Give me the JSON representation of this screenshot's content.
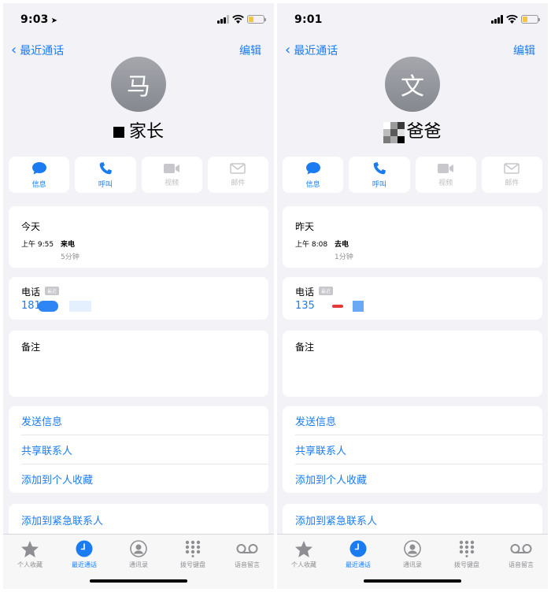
{
  "screens": [
    {
      "status": {
        "time": "9:03",
        "location_arrow": "➤"
      },
      "nav": {
        "back_label": "最近通话",
        "edit_label": "编辑"
      },
      "avatar_initial": "马",
      "name_visible": "家长",
      "actions": [
        {
          "label": "信息",
          "icon": "message-icon",
          "enabled": true
        },
        {
          "label": "呼叫",
          "icon": "phone-icon",
          "enabled": true
        },
        {
          "label": "视频",
          "icon": "video-icon",
          "enabled": false
        },
        {
          "label": "邮件",
          "icon": "mail-icon",
          "enabled": false
        }
      ],
      "recent": {
        "day": "今天",
        "time": "上午 9:55",
        "type": "来电",
        "duration": "5分钟"
      },
      "phone": {
        "label": "电话",
        "tag": "最近",
        "number_visible": "181"
      },
      "notes_label": "备注",
      "links": [
        "发送信息",
        "共享联系人",
        "添加到个人收藏"
      ],
      "emergency_label": "添加到紧急联系人"
    },
    {
      "status": {
        "time": "9:01",
        "location_arrow": ""
      },
      "nav": {
        "back_label": "最近通话",
        "edit_label": "编辑"
      },
      "avatar_initial": "文",
      "name_visible": "爸爸",
      "actions": [
        {
          "label": "信息",
          "icon": "message-icon",
          "enabled": true
        },
        {
          "label": "呼叫",
          "icon": "phone-icon",
          "enabled": true
        },
        {
          "label": "视频",
          "icon": "video-icon",
          "enabled": false
        },
        {
          "label": "邮件",
          "icon": "mail-icon",
          "enabled": false
        }
      ],
      "recent": {
        "day": "昨天",
        "time": "上午 8:08",
        "type": "去电",
        "duration": "1分钟"
      },
      "phone": {
        "label": "电话",
        "tag": "最近",
        "number_visible": "135"
      },
      "notes_label": "备注",
      "links": [
        "发送信息",
        "共享联系人",
        "添加到个人收藏"
      ],
      "emergency_label": "添加到紧急联系人"
    }
  ],
  "tabs": [
    {
      "label": "个人收藏",
      "icon": "star-icon",
      "active": false
    },
    {
      "label": "最近通话",
      "icon": "clock-icon",
      "active": true
    },
    {
      "label": "通讯录",
      "icon": "contacts-icon",
      "active": false
    },
    {
      "label": "拨号键盘",
      "icon": "keypad-icon",
      "active": false
    },
    {
      "label": "语音留言",
      "icon": "voicemail-icon",
      "active": false
    }
  ],
  "colors": {
    "accent": "#1b7cf2",
    "background": "#f2f2f7",
    "avatar": "#95979d",
    "disabled": "#bdbdc3"
  }
}
